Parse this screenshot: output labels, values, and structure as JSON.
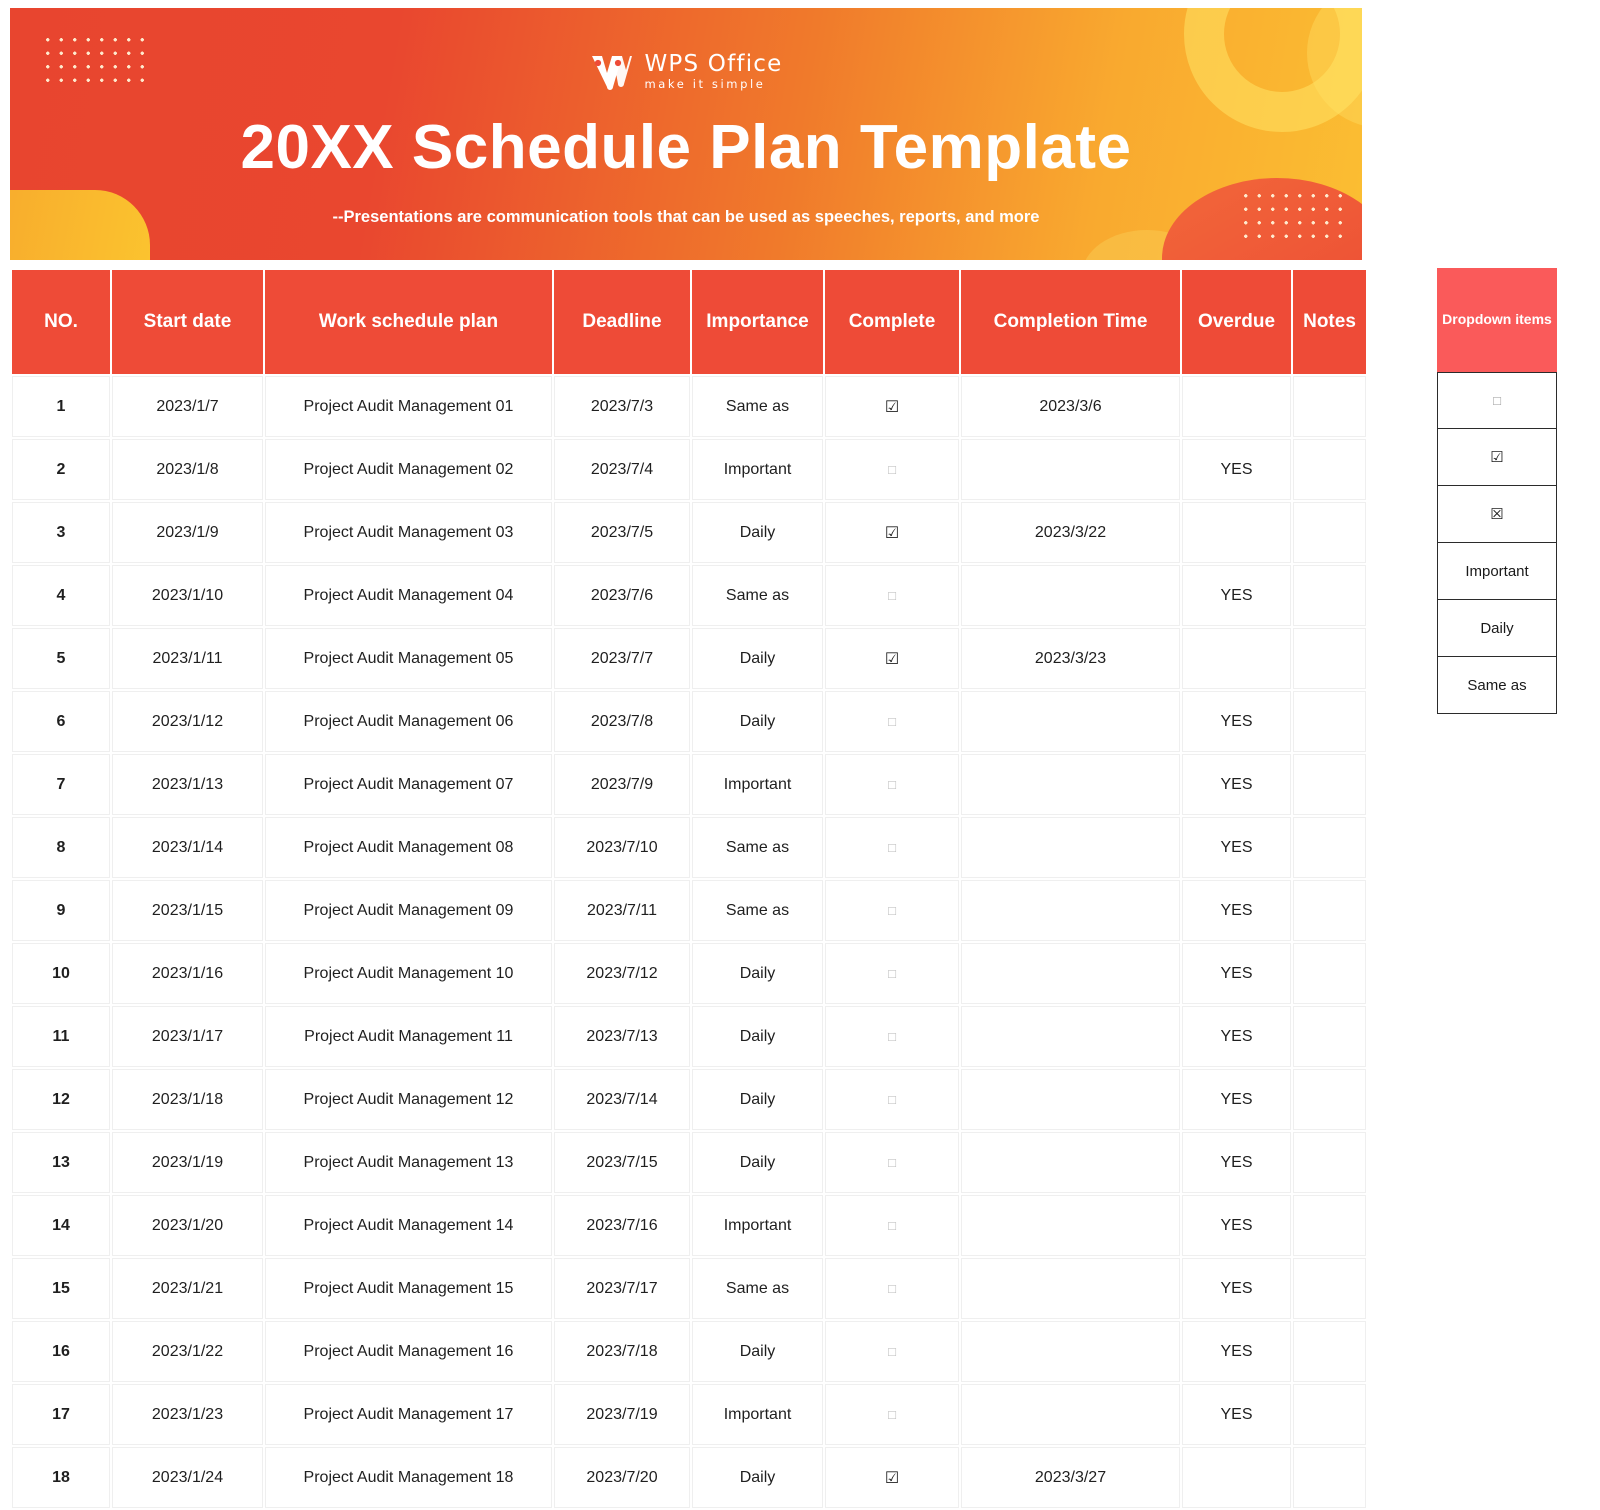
{
  "banner": {
    "logo_name": "WPS Office",
    "logo_tagline": "make it simple",
    "title": "20XX Schedule Plan Template",
    "subtitle": "--Presentations are communication tools that can be used as speeches, reports, and more",
    "colors": {
      "gradient_start": "#E8452F",
      "gradient_end": "#FBBE32",
      "text": "#FFFFFF"
    }
  },
  "table": {
    "header_color": "#EE4B37",
    "columns": [
      "NO.",
      "Start date",
      "Work schedule plan",
      "Deadline",
      "Importance",
      "Complete",
      "Completion Time",
      "Overdue",
      "Notes"
    ],
    "rows": [
      {
        "no": "1",
        "start": "2023/1/7",
        "plan": "Project Audit Management 01",
        "deadline": "2023/7/3",
        "importance": "Same as",
        "complete": "☑",
        "completion_time": "2023/3/6",
        "overdue": "",
        "notes": ""
      },
      {
        "no": "2",
        "start": "2023/1/8",
        "plan": "Project Audit Management 02",
        "deadline": "2023/7/4",
        "importance": "Important",
        "complete": "□",
        "completion_time": "",
        "overdue": "YES",
        "notes": ""
      },
      {
        "no": "3",
        "start": "2023/1/9",
        "plan": "Project Audit Management 03",
        "deadline": "2023/7/5",
        "importance": "Daily",
        "complete": "☑",
        "completion_time": "2023/3/22",
        "overdue": "",
        "notes": ""
      },
      {
        "no": "4",
        "start": "2023/1/10",
        "plan": "Project Audit Management 04",
        "deadline": "2023/7/6",
        "importance": "Same as",
        "complete": "□",
        "completion_time": "",
        "overdue": "YES",
        "notes": ""
      },
      {
        "no": "5",
        "start": "2023/1/11",
        "plan": "Project Audit Management 05",
        "deadline": "2023/7/7",
        "importance": "Daily",
        "complete": "☑",
        "completion_time": "2023/3/23",
        "overdue": "",
        "notes": ""
      },
      {
        "no": "6",
        "start": "2023/1/12",
        "plan": "Project Audit Management 06",
        "deadline": "2023/7/8",
        "importance": "Daily",
        "complete": "□",
        "completion_time": "",
        "overdue": "YES",
        "notes": ""
      },
      {
        "no": "7",
        "start": "2023/1/13",
        "plan": "Project Audit Management 07",
        "deadline": "2023/7/9",
        "importance": "Important",
        "complete": "□",
        "completion_time": "",
        "overdue": "YES",
        "notes": ""
      },
      {
        "no": "8",
        "start": "2023/1/14",
        "plan": "Project Audit Management 08",
        "deadline": "2023/7/10",
        "importance": "Same as",
        "complete": "□",
        "completion_time": "",
        "overdue": "YES",
        "notes": ""
      },
      {
        "no": "9",
        "start": "2023/1/15",
        "plan": "Project Audit Management 09",
        "deadline": "2023/7/11",
        "importance": "Same as",
        "complete": "□",
        "completion_time": "",
        "overdue": "YES",
        "notes": ""
      },
      {
        "no": "10",
        "start": "2023/1/16",
        "plan": "Project Audit Management 10",
        "deadline": "2023/7/12",
        "importance": "Daily",
        "complete": "□",
        "completion_time": "",
        "overdue": "YES",
        "notes": ""
      },
      {
        "no": "11",
        "start": "2023/1/17",
        "plan": "Project Audit Management 11",
        "deadline": "2023/7/13",
        "importance": "Daily",
        "complete": "□",
        "completion_time": "",
        "overdue": "YES",
        "notes": ""
      },
      {
        "no": "12",
        "start": "2023/1/18",
        "plan": "Project Audit Management 12",
        "deadline": "2023/7/14",
        "importance": "Daily",
        "complete": "□",
        "completion_time": "",
        "overdue": "YES",
        "notes": ""
      },
      {
        "no": "13",
        "start": "2023/1/19",
        "plan": "Project Audit Management 13",
        "deadline": "2023/7/15",
        "importance": "Daily",
        "complete": "□",
        "completion_time": "",
        "overdue": "YES",
        "notes": ""
      },
      {
        "no": "14",
        "start": "2023/1/20",
        "plan": "Project Audit Management 14",
        "deadline": "2023/7/16",
        "importance": "Important",
        "complete": "□",
        "completion_time": "",
        "overdue": "YES",
        "notes": ""
      },
      {
        "no": "15",
        "start": "2023/1/21",
        "plan": "Project Audit Management 15",
        "deadline": "2023/7/17",
        "importance": "Same as",
        "complete": "□",
        "completion_time": "",
        "overdue": "YES",
        "notes": ""
      },
      {
        "no": "16",
        "start": "2023/1/22",
        "plan": "Project Audit Management 16",
        "deadline": "2023/7/18",
        "importance": "Daily",
        "complete": "□",
        "completion_time": "",
        "overdue": "YES",
        "notes": ""
      },
      {
        "no": "17",
        "start": "2023/1/23",
        "plan": "Project Audit Management 17",
        "deadline": "2023/7/19",
        "importance": "Important",
        "complete": "□",
        "completion_time": "",
        "overdue": "YES",
        "notes": ""
      },
      {
        "no": "18",
        "start": "2023/1/24",
        "plan": "Project Audit Management 18",
        "deadline": "2023/7/20",
        "importance": "Daily",
        "complete": "☑",
        "completion_time": "2023/3/27",
        "overdue": "",
        "notes": ""
      }
    ]
  },
  "dropdown": {
    "header_label": "Dropdown items",
    "header_color": "#FA5A5A",
    "items": [
      {
        "label": "□",
        "kind": "glyph-empty-checkbox"
      },
      {
        "label": "☑",
        "kind": "glyph-checked-checkbox"
      },
      {
        "label": "☒",
        "kind": "glyph-crossed-checkbox"
      },
      {
        "label": "Important",
        "kind": "text"
      },
      {
        "label": "Daily",
        "kind": "text"
      },
      {
        "label": "Same as",
        "kind": "text"
      }
    ]
  }
}
